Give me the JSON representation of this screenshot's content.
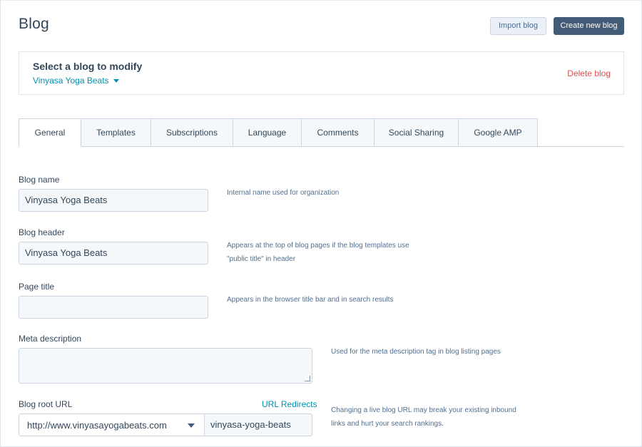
{
  "header": {
    "title": "Blog",
    "import_label": "Import blog",
    "create_label": "Create new blog"
  },
  "selector": {
    "heading": "Select a blog to modify",
    "selected_blog": "Vinyasa Yoga Beats",
    "delete_label": "Delete blog"
  },
  "tabs": [
    {
      "label": "General",
      "active": true
    },
    {
      "label": "Templates",
      "active": false
    },
    {
      "label": "Subscriptions",
      "active": false
    },
    {
      "label": "Language",
      "active": false
    },
    {
      "label": "Comments",
      "active": false
    },
    {
      "label": "Social Sharing",
      "active": false
    },
    {
      "label": "Google AMP",
      "active": false
    }
  ],
  "form": {
    "blog_name": {
      "label": "Blog name",
      "value": "Vinyasa Yoga Beats",
      "help": "Internal name used for organization"
    },
    "blog_header": {
      "label": "Blog header",
      "value": "Vinyasa Yoga Beats",
      "help_line1": "Appears at the top of blog pages if the blog templates use",
      "help_line2": "\"public title\" in header"
    },
    "page_title": {
      "label": "Page title",
      "value": "",
      "help": "Appears in the browser title bar and in search results"
    },
    "meta_description": {
      "label": "Meta description",
      "value": "",
      "help": "Used for the meta description tag in blog listing pages"
    },
    "root_url": {
      "label": "Blog root URL",
      "redirects_label": "URL Redirects",
      "domain": "http://www.vinyasayogabeats.com",
      "slug": "vinyasa-yoga-beats",
      "help_line1": "Changing a live blog URL may break your existing inbound",
      "help_line2": "links and hurt your search rankings."
    }
  },
  "colors": {
    "primary_button": "#425b76",
    "link": "#0091ae",
    "danger": "#d9534f",
    "input_bg": "#f5f8fa",
    "border": "#cbd6e2"
  },
  "icons": {
    "blog_select_caret": "caret-down-icon",
    "url_select_caret": "caret-down-icon",
    "textarea_resize": "resize-handle-icon"
  }
}
